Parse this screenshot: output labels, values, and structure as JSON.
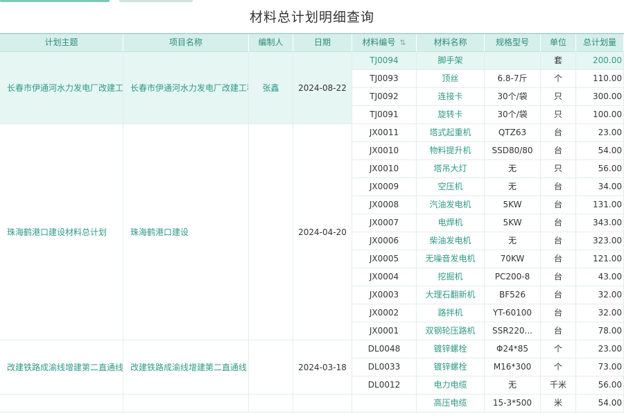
{
  "page": {
    "title": "材料总计划明细查询"
  },
  "columns": {
    "plan_subject": "计划主题",
    "project_name": "项目名称",
    "creator": "编制人",
    "date": "日期",
    "material_code": "材料编号",
    "material_name": "材料名称",
    "spec": "规格型号",
    "unit": "单位",
    "total_qty": "总计划量"
  },
  "groups": [
    {
      "plan_subject": "长春市伊通河水力发电厂改建工程",
      "project_name": "长春市伊通河水力发电厂改建工程",
      "creator": "张鑫",
      "date": "2024-08-22",
      "rows": [
        {
          "code": "TJ0094",
          "name": "脚手架",
          "spec": "",
          "unit": "套",
          "qty": "200.00"
        },
        {
          "code": "TJ0093",
          "name": "顶丝",
          "spec": "6.8-7斤",
          "unit": "个",
          "qty": "110.00"
        },
        {
          "code": "TJ0092",
          "name": "连接卡",
          "spec": "30个/袋",
          "unit": "只",
          "qty": "300.00"
        },
        {
          "code": "TJ0091",
          "name": "旋转卡",
          "spec": "30个/袋",
          "unit": "只",
          "qty": "100.00"
        }
      ]
    },
    {
      "plan_subject": "珠海鹤港口建设材料总计划",
      "project_name": "珠海鹤港口建设",
      "creator": "",
      "date": "2024-04-20",
      "rows": [
        {
          "code": "JX0011",
          "name": "塔式起重机",
          "spec": "QTZ63",
          "unit": "台",
          "qty": "23.00"
        },
        {
          "code": "JX0010",
          "name": "物料提升机",
          "spec": "SSD80/80",
          "unit": "台",
          "qty": "54.00"
        },
        {
          "code": "JX0010",
          "name": "塔吊大灯",
          "spec": "无",
          "unit": "只",
          "qty": "56.00"
        },
        {
          "code": "JX0009",
          "name": "空压机",
          "spec": "无",
          "unit": "台",
          "qty": "34.00"
        },
        {
          "code": "JX0008",
          "name": "汽油发电机",
          "spec": "5KW",
          "unit": "台",
          "qty": "131.00"
        },
        {
          "code": "JX0007",
          "name": "电焊机",
          "spec": "5KW",
          "unit": "台",
          "qty": "343.00"
        },
        {
          "code": "JX0006",
          "name": "柴油发电机",
          "spec": "无",
          "unit": "台",
          "qty": "323.00"
        },
        {
          "code": "JX0005",
          "name": "无噪音发电机",
          "spec": "70KW",
          "unit": "台",
          "qty": "121.00"
        },
        {
          "code": "JX0004",
          "name": "挖掘机",
          "spec": "PC200-8",
          "unit": "台",
          "qty": "43.00"
        },
        {
          "code": "JX0003",
          "name": "大理石翻新机",
          "spec": "BF526",
          "unit": "台",
          "qty": "32.00"
        },
        {
          "code": "JX0002",
          "name": "路拌机",
          "spec": "YT-60100",
          "unit": "台",
          "qty": "32.00"
        },
        {
          "code": "JX0001",
          "name": "双钢轮压路机",
          "spec": "SSR220...",
          "unit": "台",
          "qty": "78.00"
        }
      ]
    },
    {
      "plan_subject": "改建铁路成渝线增建第二直通线",
      "project_name": "改建铁路成渝线增建第二直通线",
      "creator": "",
      "date": "2024-03-18",
      "rows": [
        {
          "code": "DL0048",
          "name": "镀锌螺栓",
          "spec": "Φ24*85",
          "unit": "个",
          "qty": "23.00"
        },
        {
          "code": "DL0033",
          "name": "镀锌螺栓",
          "spec": "M16*300",
          "unit": "个",
          "qty": "73.00"
        },
        {
          "code": "DL0012",
          "name": "电力电缆",
          "spec": "无",
          "unit": "千米",
          "qty": "56.00"
        }
      ]
    },
    {
      "plan_subject": "",
      "project_name": "",
      "creator": "",
      "date": "",
      "rows": [
        {
          "code": "",
          "name": "高压电缆",
          "spec": "15-3*500",
          "unit": "米",
          "qty": "54.00"
        }
      ]
    }
  ],
  "colors": {
    "accent": "#2e9a86",
    "header_bg": "#d6efea",
    "highlight_bg": "#e6f6f3"
  }
}
